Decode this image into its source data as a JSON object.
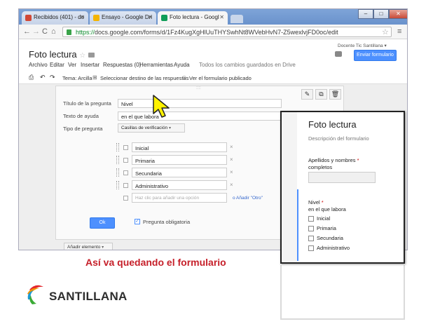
{
  "browser": {
    "tabs": [
      {
        "label": "Recibidos (401) - do",
        "icon_color": "#d14836"
      },
      {
        "label": "Ensayo - Google Dri",
        "icon_color": "#f4b400"
      },
      {
        "label": "Foto lectura - Googl",
        "icon_color": "#0f9d58"
      }
    ],
    "window_buttons": {
      "minimize": "–",
      "maximize": "□",
      "close": "✕"
    },
    "url_prefix": "https://",
    "url_rest": "docs.google.com/forms/d/1Fz4KugXgHlUuTHYSwhNt8WVebHvN7-Z5wexlvjFD0oc/edit",
    "nav_icons": [
      "back-icon",
      "forward-icon",
      "reload-icon",
      "home-icon",
      "star-icon",
      "menu-icon"
    ]
  },
  "form_app": {
    "title": "Foto lectura",
    "owner": "Docente Tic Santillana ▾",
    "send_button": "Enviar formulario",
    "menu": [
      "Archivo",
      "Editar",
      "Ver",
      "Insertar",
      "Respuestas (0)",
      "Herramientas",
      "Ayuda"
    ],
    "saved_status": "Todos los cambios guardados en Drive",
    "toolbar": {
      "theme": "Tema: Arcilla",
      "select_dest": "Seleccionar destino de las respuestas",
      "published": "Ver el formulario publicado"
    },
    "editor": {
      "title_label": "Título de la pregunta",
      "title_value": "Nivel",
      "help_label": "Texto de ayuda",
      "help_value": "en el que labora",
      "type_label": "Tipo de pregunta",
      "type_value": "Casillas de verificación",
      "options": [
        "Inicial",
        "Primaria",
        "Secundaria",
        "Administrativo"
      ],
      "add_option_placeholder": "Haz clic para añadir una opción",
      "add_other": "o Añadir \"Otro\"",
      "ok": "Ok",
      "required": "Pregunta obligatoria",
      "handle": "::::",
      "remove_symbol": "×"
    },
    "add_item": "Añadir elemento"
  },
  "preview": {
    "title": "Foto lectura",
    "description": "Descripción del formulario",
    "q1_label": "Apellidos y nombres",
    "q1_sub": "completos",
    "q2_label": "Nivel",
    "q2_help": "en el que labora",
    "required_mark": "*",
    "options": [
      "Inicial",
      "Primaria",
      "Secundaria",
      "Administrativo"
    ]
  },
  "caption": "Así va quedando el formulario",
  "logo": {
    "text": "SANTILLANA",
    "colors": [
      "#e3262d",
      "#f29400",
      "#1c9ad6",
      "#3aaa35"
    ]
  },
  "colors": {
    "accent": "#4d90fe",
    "caption": "#c6202a"
  }
}
